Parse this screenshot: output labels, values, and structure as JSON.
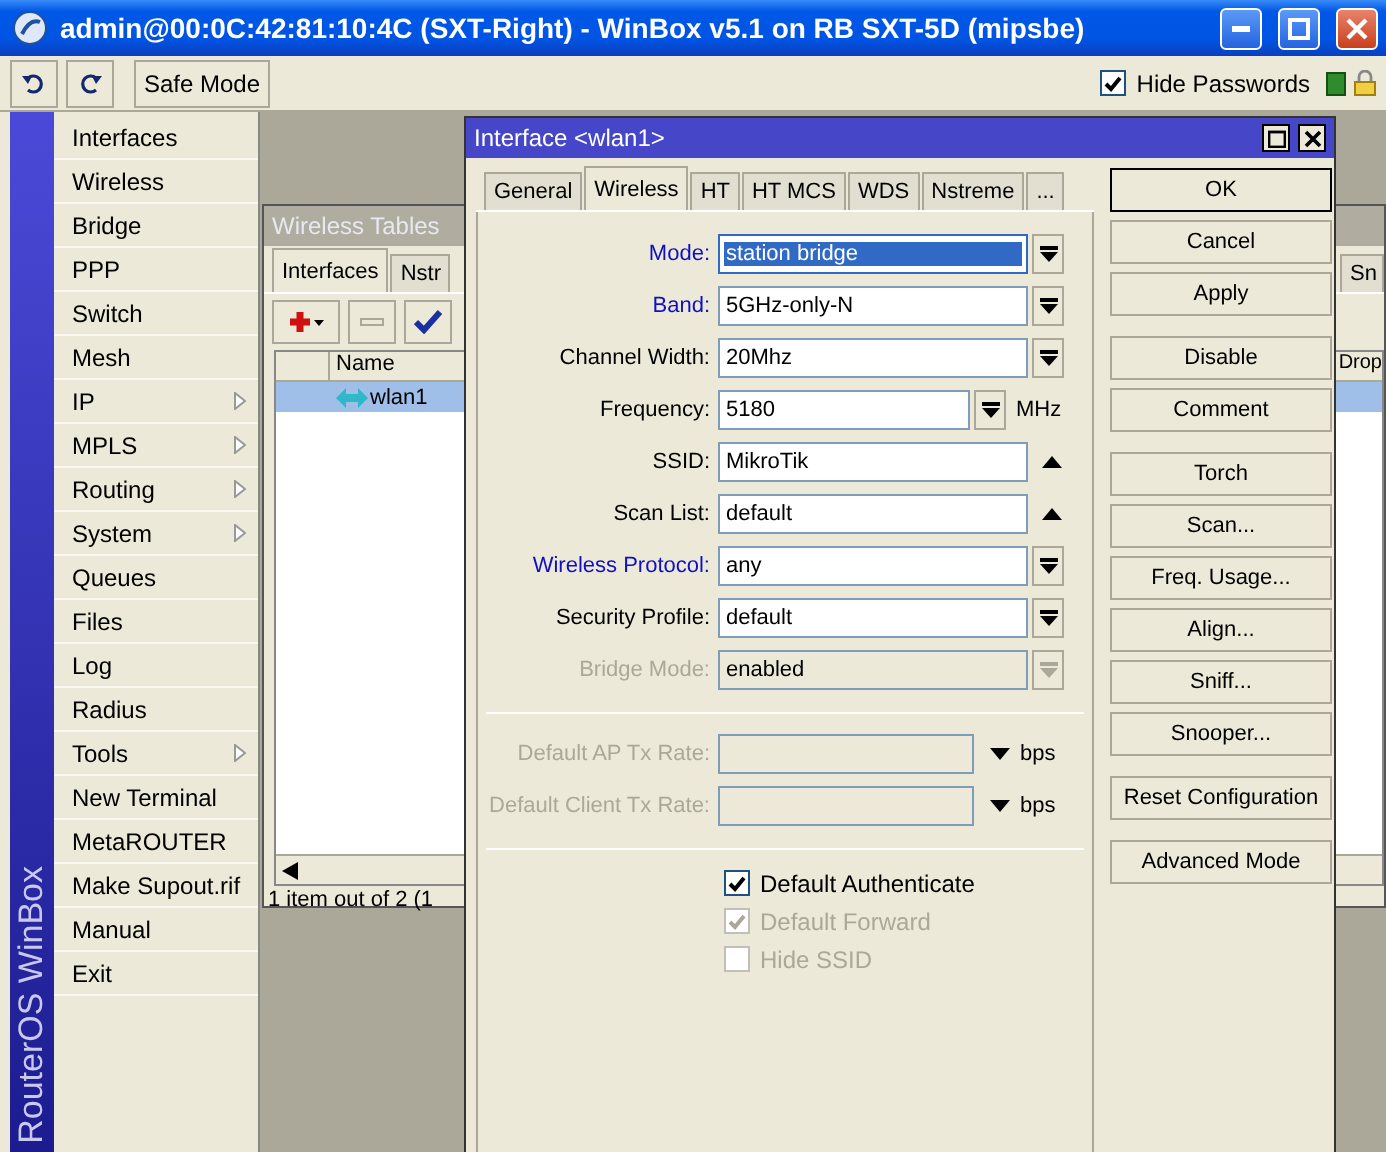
{
  "window": {
    "title": "admin@00:0C:42:81:10:4C (SXT-Right) - WinBox v5.1 on RB SXT-5D (mipsbe)"
  },
  "toolbar": {
    "safe_mode": "Safe Mode",
    "hide_passwords": {
      "label": "Hide Passwords",
      "checked": true
    }
  },
  "sidebar": {
    "brand": "RouterOS WinBox",
    "items": [
      {
        "label": "Interfaces",
        "submenu": false
      },
      {
        "label": "Wireless",
        "submenu": false
      },
      {
        "label": "Bridge",
        "submenu": false
      },
      {
        "label": "PPP",
        "submenu": false
      },
      {
        "label": "Switch",
        "submenu": false
      },
      {
        "label": "Mesh",
        "submenu": false
      },
      {
        "label": "IP",
        "submenu": true
      },
      {
        "label": "MPLS",
        "submenu": true
      },
      {
        "label": "Routing",
        "submenu": true
      },
      {
        "label": "System",
        "submenu": true
      },
      {
        "label": "Queues",
        "submenu": false
      },
      {
        "label": "Files",
        "submenu": false
      },
      {
        "label": "Log",
        "submenu": false
      },
      {
        "label": "Radius",
        "submenu": false
      },
      {
        "label": "Tools",
        "submenu": true
      },
      {
        "label": "New Terminal",
        "submenu": false
      },
      {
        "label": "MetaROUTER",
        "submenu": false
      },
      {
        "label": "Make Supout.rif",
        "submenu": false
      },
      {
        "label": "Manual",
        "submenu": false
      },
      {
        "label": "Exit",
        "submenu": false
      }
    ]
  },
  "wireless_tables": {
    "title": "Wireless Tables",
    "tabs": [
      {
        "label": "Interfaces",
        "selected": true
      },
      {
        "label": "Nstr",
        "selected": false
      }
    ],
    "right_tab": "Sn",
    "columns": [
      "Name"
    ],
    "right_column": "Drop",
    "rows": [
      {
        "name": "wlan1",
        "selected": true
      }
    ],
    "status": "1 item out of 2 (1"
  },
  "dialog": {
    "title": "Interface <wlan1>",
    "tabs": [
      {
        "label": "General",
        "selected": false
      },
      {
        "label": "Wireless",
        "selected": true
      },
      {
        "label": "HT",
        "selected": false
      },
      {
        "label": "HT MCS",
        "selected": false
      },
      {
        "label": "WDS",
        "selected": false
      },
      {
        "label": "Nstreme",
        "selected": false
      },
      {
        "label": "...",
        "selected": false
      }
    ],
    "sections": [
      {
        "kind": "fields",
        "fields": [
          {
            "label": "Mode:",
            "value": "station bridge",
            "kind": "select",
            "emphasis": true,
            "disabled": false,
            "selected": true
          },
          {
            "label": "Band:",
            "value": "5GHz-only-N",
            "kind": "select",
            "emphasis": true,
            "disabled": false,
            "selected": false
          },
          {
            "label": "Channel Width:",
            "value": "20Mhz",
            "kind": "select",
            "emphasis": false,
            "disabled": false,
            "selected": false
          },
          {
            "label": "Frequency:",
            "value": "5180",
            "kind": "combo",
            "unit": "MHz",
            "emphasis": false,
            "disabled": false,
            "selected": false
          },
          {
            "label": "SSID:",
            "value": "MikroTik",
            "kind": "text",
            "emphasis": false,
            "disabled": false,
            "selected": false
          },
          {
            "label": "Scan List:",
            "value": "default",
            "kind": "text",
            "emphasis": false,
            "disabled": false,
            "selected": false
          },
          {
            "label": "Wireless Protocol:",
            "value": "any",
            "kind": "select",
            "emphasis": true,
            "disabled": false,
            "selected": false
          },
          {
            "label": "Security Profile:",
            "value": "default",
            "kind": "select",
            "emphasis": false,
            "disabled": false,
            "selected": false
          },
          {
            "label": "Bridge Mode:",
            "value": "enabled",
            "kind": "select",
            "disabled": true,
            "selected": false
          }
        ]
      },
      {
        "kind": "fields",
        "fields": [
          {
            "label": "Default AP Tx Rate:",
            "kind": "rate",
            "unit": "bps",
            "disabled": true
          },
          {
            "label": "Default Client Tx Rate:",
            "kind": "rate",
            "unit": "bps",
            "disabled": true
          }
        ]
      },
      {
        "kind": "checkboxes",
        "items": [
          {
            "label": "Default Authenticate",
            "checked": true,
            "disabled": false
          },
          {
            "label": "Default Forward",
            "checked": true,
            "disabled": true
          },
          {
            "label": "Hide SSID",
            "checked": false,
            "disabled": true
          }
        ]
      }
    ],
    "button_groups": [
      [
        {
          "label": "OK",
          "default": true
        },
        {
          "label": "Cancel",
          "default": false
        },
        {
          "label": "Apply",
          "default": false
        }
      ],
      [
        {
          "label": "Disable",
          "default": false
        },
        {
          "label": "Comment",
          "default": false
        }
      ],
      [
        {
          "label": "Torch",
          "default": false
        },
        {
          "label": "Scan...",
          "default": false
        },
        {
          "label": "Freq. Usage...",
          "default": false
        },
        {
          "label": "Align...",
          "default": false
        },
        {
          "label": "Sniff...",
          "default": false
        },
        {
          "label": "Snooper...",
          "default": false
        }
      ],
      [
        {
          "label": "Reset Configuration",
          "default": false
        }
      ],
      [
        {
          "label": "Advanced Mode",
          "default": false
        }
      ]
    ]
  }
}
